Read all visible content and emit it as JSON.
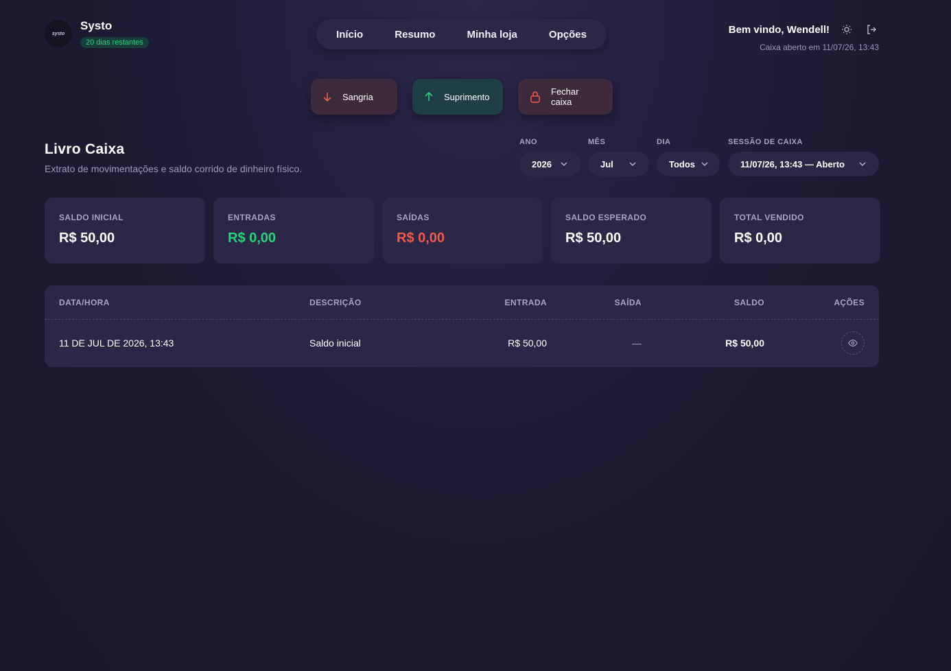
{
  "brand": {
    "logo_text": "systo",
    "name": "Systo",
    "trial": "20 dias restantes"
  },
  "nav": {
    "items": [
      "Início",
      "Resumo",
      "Minha loja",
      "Opções"
    ]
  },
  "user": {
    "welcome": "Bem vindo, Wendell!",
    "session_open": "Caixa aberto em 11/07/26, 13:43"
  },
  "actions": {
    "sangria": "Sangria",
    "suprimento": "Suprimento",
    "fechar": "Fechar caixa"
  },
  "section": {
    "title": "Livro Caixa",
    "subtitle": "Extrato de movimentações e saldo corrido de dinheiro físico."
  },
  "filters": {
    "ano": {
      "label": "ANO",
      "value": "2026"
    },
    "mes": {
      "label": "MÊS",
      "value": "Jul"
    },
    "dia": {
      "label": "DIA",
      "value": "Todos"
    },
    "sessao": {
      "label": "SESSÃO DE CAIXA",
      "value": "11/07/26, 13:43 — Aberto"
    }
  },
  "cards": [
    {
      "label": "SALDO INICIAL",
      "value": "R$ 50,00"
    },
    {
      "label": "ENTRADAS",
      "value": "R$ 0,00"
    },
    {
      "label": "SAÍDAS",
      "value": "R$ 0,00"
    },
    {
      "label": "SALDO ESPERADO",
      "value": "R$ 50,00"
    },
    {
      "label": "TOTAL VENDIDO",
      "value": "R$ 0,00"
    }
  ],
  "table": {
    "headers": [
      "DATA/HORA",
      "DESCRIÇÃO",
      "ENTRADA",
      "SAÍDA",
      "SALDO",
      "AÇÕES"
    ],
    "rows": [
      {
        "datetime": "11 DE JUL DE 2026, 13:43",
        "description": "Saldo inicial",
        "entrada": "R$ 50,00",
        "saida": "—",
        "saldo": "R$ 50,00"
      }
    ]
  },
  "colors": {
    "green": "#27d27a",
    "red": "#ef5a4c",
    "card_bg": "#2b2747"
  },
  "icons": {
    "theme": "sun-icon",
    "logout": "logout-icon",
    "sangria": "arrow-down-icon",
    "suprimento": "arrow-up-icon",
    "fechar": "lock-icon",
    "view": "eye-icon"
  }
}
